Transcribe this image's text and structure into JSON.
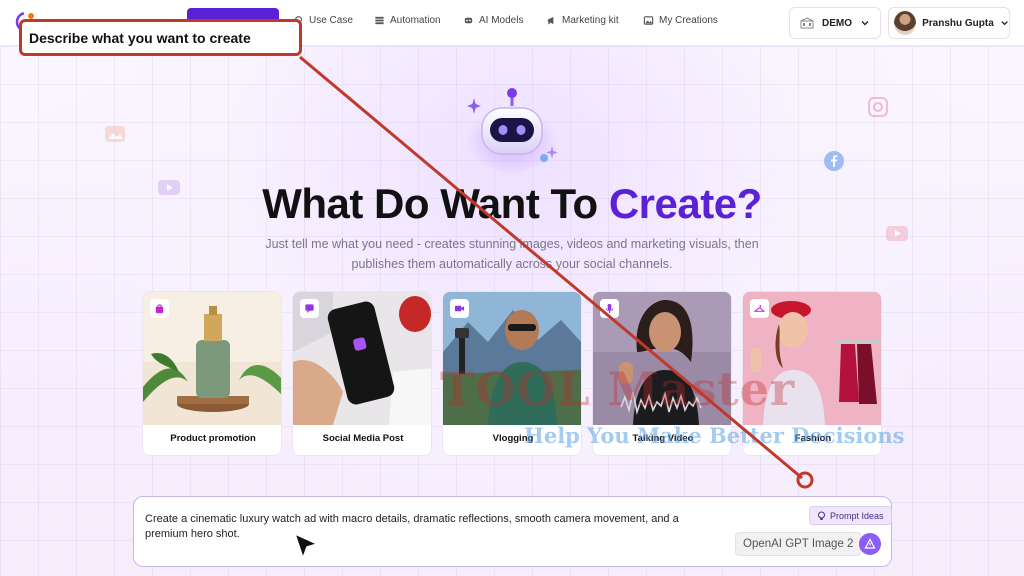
{
  "header": {
    "nav": [
      {
        "label": "Use Case",
        "icon": "bulb-icon"
      },
      {
        "label": "Automation",
        "icon": "automation-icon"
      },
      {
        "label": "AI Models",
        "icon": "robot-icon"
      },
      {
        "label": "Marketing kit",
        "icon": "megaphone-icon"
      },
      {
        "label": "My Creations",
        "icon": "image-icon"
      }
    ],
    "workspace": "DEMO",
    "user_name": "Pranshu Gupta"
  },
  "callout": {
    "text": "Describe what you want to create"
  },
  "hero": {
    "title_main": "What Do Want To ",
    "title_accent": "Create?",
    "subtitle": "Just tell me what you need - creates stunning images, videos and marketing visuals, then publishes them automatically across your social channels."
  },
  "cards": [
    {
      "label": "Product promotion",
      "icon": "shopping-bag-icon"
    },
    {
      "label": "Social Media Post",
      "icon": "chat-icon"
    },
    {
      "label": "Vlogging",
      "icon": "video-camera-icon"
    },
    {
      "label": "Talking Video",
      "icon": "microphone-icon"
    },
    {
      "label": "Fashion",
      "icon": "hanger-icon"
    }
  ],
  "watermark": {
    "text": "TOOL Master",
    "tagline": "Help You Make Better Decisions"
  },
  "prompt": {
    "text": "Create a cinematic luxury watch ad with macro details, dramatic reflections, smooth camera movement, and a premium hero shot.",
    "ideas_label": "Prompt Ideas",
    "model": "OpenAI GPT Image 2"
  },
  "colors": {
    "accent": "#5b21d6",
    "annotation": "#c0392b"
  }
}
